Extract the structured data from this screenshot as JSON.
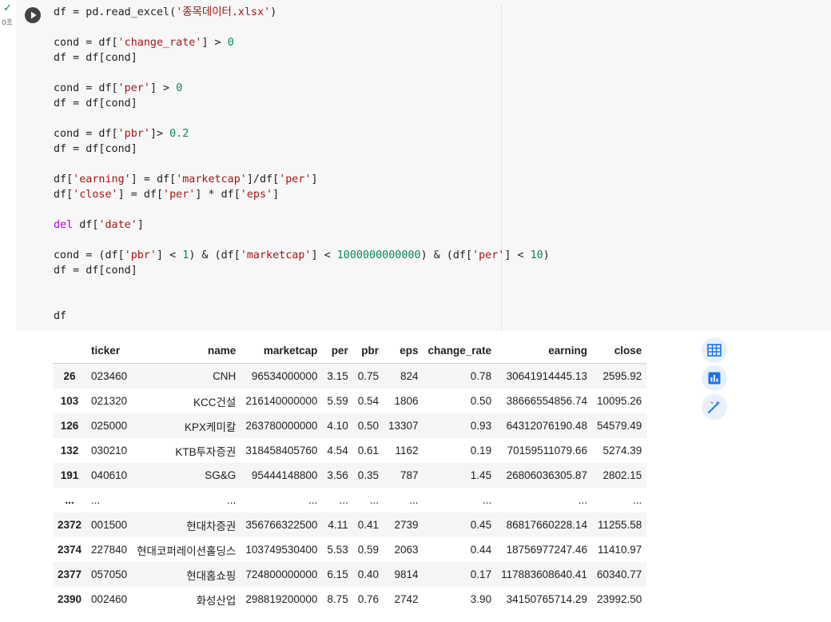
{
  "cell": {
    "exec_time": "0초",
    "code_lines": [
      [
        {
          "t": "df = pd.read_excel("
        },
        {
          "t": "'종목데이터.xlsx'",
          "c": "str"
        },
        {
          "t": ")"
        }
      ],
      [],
      [
        {
          "t": "cond = df["
        },
        {
          "t": "'change_rate'",
          "c": "str"
        },
        {
          "t": "] > "
        },
        {
          "t": "0",
          "c": "num"
        }
      ],
      [
        {
          "t": "df = df[cond]"
        }
      ],
      [],
      [
        {
          "t": "cond = df["
        },
        {
          "t": "'per'",
          "c": "str"
        },
        {
          "t": "] > "
        },
        {
          "t": "0",
          "c": "num"
        }
      ],
      [
        {
          "t": "df = df[cond]"
        }
      ],
      [],
      [
        {
          "t": "cond = df["
        },
        {
          "t": "'pbr'",
          "c": "str"
        },
        {
          "t": "]> "
        },
        {
          "t": "0.2",
          "c": "num"
        }
      ],
      [
        {
          "t": "df = df[cond]"
        }
      ],
      [],
      [
        {
          "t": "df["
        },
        {
          "t": "'earning'",
          "c": "str"
        },
        {
          "t": "] = df["
        },
        {
          "t": "'marketcap'",
          "c": "str"
        },
        {
          "t": "]/df["
        },
        {
          "t": "'per'",
          "c": "str"
        },
        {
          "t": "]"
        }
      ],
      [
        {
          "t": "df["
        },
        {
          "t": "'close'",
          "c": "str"
        },
        {
          "t": "] = df["
        },
        {
          "t": "'per'",
          "c": "str"
        },
        {
          "t": "] * df["
        },
        {
          "t": "'eps'",
          "c": "str"
        },
        {
          "t": "]"
        }
      ],
      [],
      [
        {
          "t": "del",
          "c": "kw"
        },
        {
          "t": " df["
        },
        {
          "t": "'date'",
          "c": "str"
        },
        {
          "t": "]"
        }
      ],
      [],
      [
        {
          "t": "cond = (df["
        },
        {
          "t": "'pbr'",
          "c": "str"
        },
        {
          "t": "] < "
        },
        {
          "t": "1",
          "c": "num"
        },
        {
          "t": ") & (df["
        },
        {
          "t": "'marketcap'",
          "c": "str"
        },
        {
          "t": "] < "
        },
        {
          "t": "1000000000000",
          "c": "num"
        },
        {
          "t": ") & (df["
        },
        {
          "t": "'per'",
          "c": "str"
        },
        {
          "t": "] < "
        },
        {
          "t": "10",
          "c": "num"
        },
        {
          "t": ")"
        }
      ],
      [
        {
          "t": "df = df[cond]"
        }
      ],
      [],
      [],
      [
        {
          "t": "df"
        }
      ]
    ]
  },
  "table": {
    "columns": [
      "",
      "ticker",
      "name",
      "marketcap",
      "per",
      "pbr",
      "eps",
      "change_rate",
      "earning",
      "close"
    ],
    "rows": [
      [
        "26",
        "023460",
        "CNH",
        "96534000000",
        "3.15",
        "0.75",
        "824",
        "0.78",
        "30641914445.13",
        "2595.92"
      ],
      [
        "103",
        "021320",
        "KCC건설",
        "216140000000",
        "5.59",
        "0.54",
        "1806",
        "0.50",
        "38666554856.74",
        "10095.26"
      ],
      [
        "126",
        "025000",
        "KPX케미칼",
        "263780000000",
        "4.10",
        "0.50",
        "13307",
        "0.93",
        "64312076190.48",
        "54579.49"
      ],
      [
        "132",
        "030210",
        "KTB투자증권",
        "318458405760",
        "4.54",
        "0.61",
        "1162",
        "0.19",
        "70159511079.66",
        "5274.39"
      ],
      [
        "191",
        "040610",
        "SG&G",
        "95444148800",
        "3.56",
        "0.35",
        "787",
        "1.45",
        "26806036305.87",
        "2802.15"
      ],
      [
        "...",
        "...",
        "...",
        "...",
        "...",
        "...",
        "...",
        "...",
        "...",
        "..."
      ],
      [
        "2372",
        "001500",
        "현대차증권",
        "356766322500",
        "4.11",
        "0.41",
        "2739",
        "0.45",
        "86817660228.14",
        "11255.58"
      ],
      [
        "2374",
        "227840",
        "현대코퍼레이션홀딩스",
        "103749530400",
        "5.53",
        "0.59",
        "2063",
        "0.44",
        "18756977247.46",
        "11410.97"
      ],
      [
        "2377",
        "057050",
        "현대홈쇼핑",
        "724800000000",
        "6.15",
        "0.40",
        "9814",
        "0.17",
        "117883608640.41",
        "60340.77"
      ],
      [
        "2390",
        "002460",
        "화성산업",
        "298819200000",
        "8.75",
        "0.76",
        "2742",
        "3.90",
        "34150765714.29",
        "23992.50"
      ]
    ]
  },
  "toolbar": {
    "icons": [
      "table-icon",
      "chart-icon",
      "magic-wand-icon"
    ]
  },
  "colors": {
    "accent": "#1a73e8",
    "string": "#a31515",
    "number": "#098658",
    "keyword": "#af00db"
  }
}
